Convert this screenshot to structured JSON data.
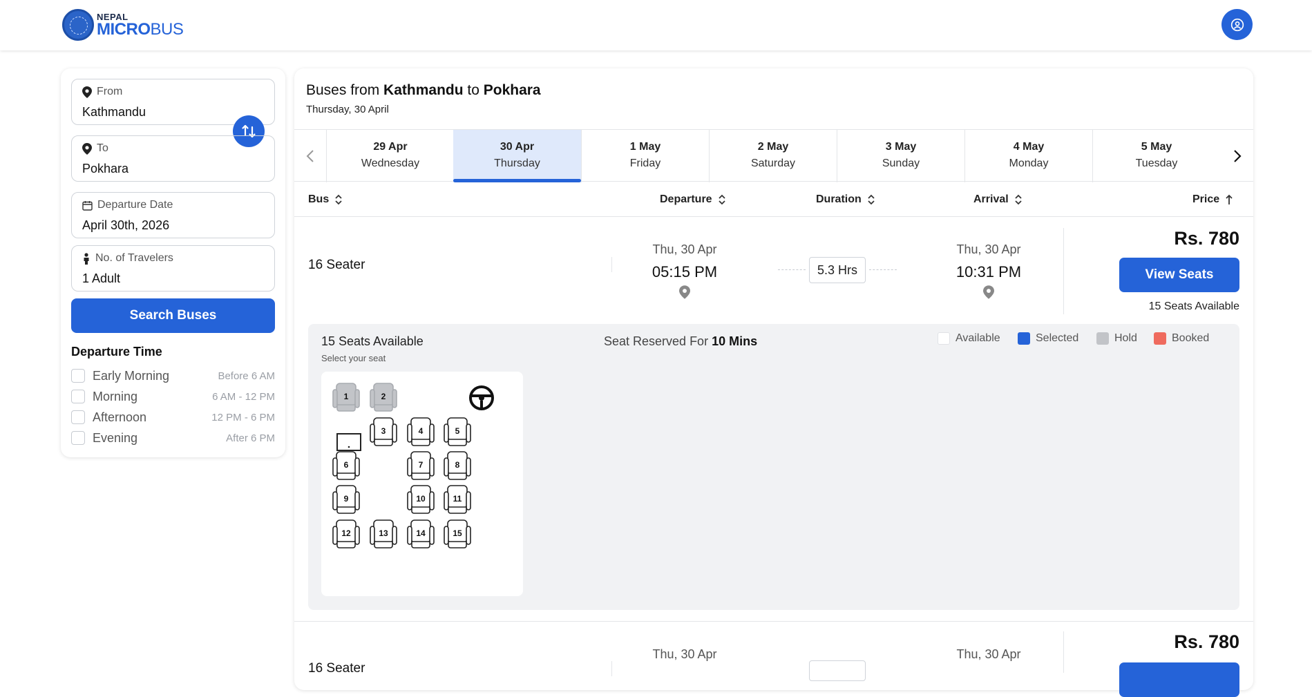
{
  "header": {
    "logo_top": "NEPAL",
    "logo_main_bold": "MICRO",
    "logo_main_light": "BUS",
    "seal_text": "Nepal Microbus seal",
    "profile_icon": "user-circle-icon"
  },
  "search": {
    "from_label": "From",
    "from_value": "Kathmandu",
    "to_label": "To",
    "to_value": "Pokhara",
    "date_label": "Departure Date",
    "date_value": "April 30th, 2026",
    "travelers_label": "No. of Travelers",
    "travelers_value": "1 Adult",
    "search_button": "Search Buses"
  },
  "filters": {
    "title": "Departure Time",
    "options": [
      {
        "name": "Early Morning",
        "range": "Before 6 AM"
      },
      {
        "name": "Morning",
        "range": "6 AM - 12 PM"
      },
      {
        "name": "Afternoon",
        "range": "12 PM - 6 PM"
      },
      {
        "name": "Evening",
        "range": "After 6 PM"
      }
    ]
  },
  "results": {
    "title_prefix": "Buses from ",
    "from": "Kathmandu",
    "title_mid": " to ",
    "to": "Pokhara",
    "subtitle": "Thursday, 30 April",
    "dates": [
      {
        "date": "29 Apr",
        "day": "Wednesday"
      },
      {
        "date": "30 Apr",
        "day": "Thursday"
      },
      {
        "date": "1 May",
        "day": "Friday"
      },
      {
        "date": "2 May",
        "day": "Saturday"
      },
      {
        "date": "3 May",
        "day": "Sunday"
      },
      {
        "date": "4 May",
        "day": "Monday"
      },
      {
        "date": "5 May",
        "day": "Tuesday"
      }
    ],
    "selected_date": "30 Apr",
    "columns": {
      "bus": "Bus",
      "departure": "Departure",
      "duration": "Duration",
      "arrival": "Arrival",
      "price": "Price"
    },
    "buses": [
      {
        "name": "16 Seater",
        "dep_date": "Thu, 30 Apr",
        "dep_time": "05:15 PM",
        "duration": "5.3 Hrs",
        "arr_date": "Thu, 30 Apr",
        "arr_time": "10:31 PM",
        "price": "Rs. 780",
        "view_button": "View Seats",
        "seats_available": "15 Seats Available"
      },
      {
        "name": "16 Seater",
        "dep_date": "Thu, 30 Apr",
        "arr_date": "Thu, 30 Apr",
        "price": "Rs. 780"
      }
    ]
  },
  "seat_panel": {
    "title": "15 Seats Available",
    "subtitle": "Select your seat",
    "reserved_prefix": "Seat Reserved For ",
    "reserved_time": "10 Mins",
    "legend": [
      {
        "label": "Available",
        "color": "#ffffff"
      },
      {
        "label": "Selected",
        "color": "#2563d8"
      },
      {
        "label": "Hold",
        "color": "#c2c4c8"
      },
      {
        "label": "Booked",
        "color": "#ef6b5e"
      }
    ],
    "seats": [
      {
        "n": "1",
        "status": "hold"
      },
      {
        "n": "2",
        "status": "hold"
      },
      {
        "n": "3",
        "status": "available"
      },
      {
        "n": "4",
        "status": "available"
      },
      {
        "n": "5",
        "status": "available"
      },
      {
        "n": "6",
        "status": "available"
      },
      {
        "n": "7",
        "status": "available"
      },
      {
        "n": "8",
        "status": "available"
      },
      {
        "n": "9",
        "status": "available"
      },
      {
        "n": "10",
        "status": "available"
      },
      {
        "n": "11",
        "status": "available"
      },
      {
        "n": "12",
        "status": "available"
      },
      {
        "n": "13",
        "status": "available"
      },
      {
        "n": "14",
        "status": "available"
      },
      {
        "n": "15",
        "status": "available"
      }
    ]
  }
}
